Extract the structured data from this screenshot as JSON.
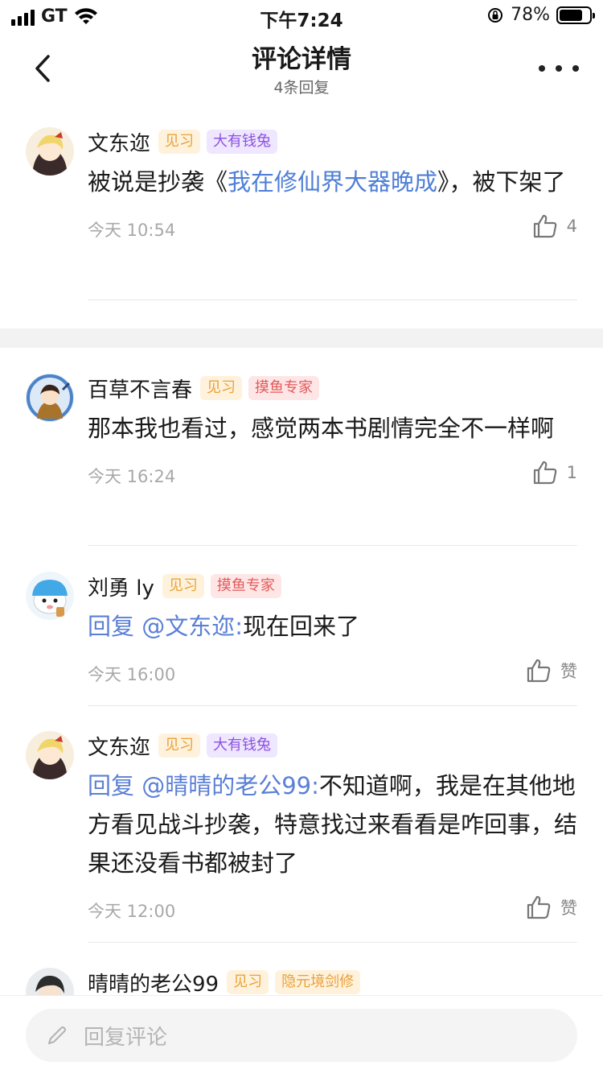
{
  "status_bar": {
    "carrier": "GT",
    "time": "下午7:24",
    "battery_percent": "78%",
    "battery_level": 0.78
  },
  "nav": {
    "title": "评论详情",
    "subtitle": "4条回复"
  },
  "comments": [
    {
      "name": "文东迩",
      "badges": [
        "见习",
        "大有钱兔"
      ],
      "text_before": "被说是抄袭《",
      "link": "我在修仙界大器晚成",
      "text_after": "》，被下架了",
      "time": "今天 10:54",
      "likes": "4",
      "avatar": "anime-avatar-blonde"
    },
    {
      "name": "百草不言春",
      "badges": [
        "见习",
        "摸鱼专家"
      ],
      "text": "那本我也看过，感觉两本书剧情完全不一样啊",
      "time": "今天 16:24",
      "likes": "1",
      "avatar": "anime-avatar-blue-frame"
    },
    {
      "name": "刘勇 ly",
      "badges": [
        "见习",
        "摸鱼专家"
      ],
      "reply_prefix": "回复 @文东迩:",
      "text": "现在回来了",
      "time": "今天 16:00",
      "likes": "赞",
      "avatar": "cartoon-avatar-blue-hat"
    },
    {
      "name": "文东迩",
      "badges": [
        "见习",
        "大有钱兔"
      ],
      "reply_prefix": "回复 @晴晴的老公99:",
      "text": "不知道啊，我是在其他地方看见战斗抄袭，特意找过来看看是咋回事，结果还没看书都被封了",
      "time": "今天 12:00",
      "likes": "赞",
      "avatar": "anime-avatar-blonde"
    },
    {
      "name": "晴晴的老公99",
      "badges": [
        "见习",
        "隐元境剑修"
      ],
      "avatar": "anime-avatar-dark-hair"
    }
  ],
  "reply_bar": {
    "placeholder": "回复评论",
    "icon": "pencil-icon"
  },
  "colors": {
    "link": "#4f7fd6",
    "level_badge": "#e8a13a",
    "purple_badge": "#8b53e0",
    "red_badge": "#e05a5a"
  }
}
